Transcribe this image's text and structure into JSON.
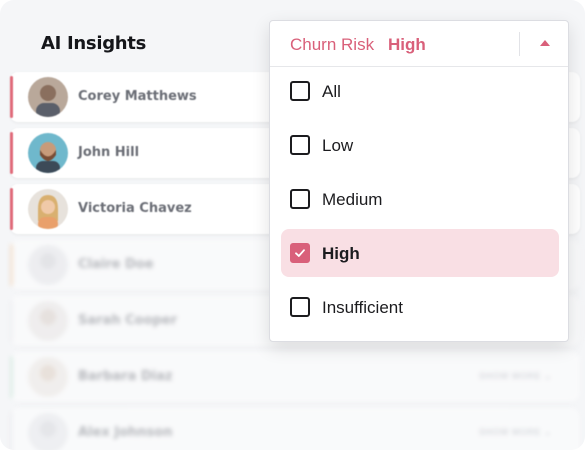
{
  "header": {
    "title": "AI Insights"
  },
  "filter": {
    "label": "Churn Risk",
    "value": "High",
    "accent_color": "#d9607a",
    "options": [
      {
        "label": "All",
        "checked": false
      },
      {
        "label": "Low",
        "checked": false
      },
      {
        "label": "Medium",
        "checked": false
      },
      {
        "label": "High",
        "checked": true
      },
      {
        "label": "Insufficient",
        "checked": false
      }
    ]
  },
  "contacts": [
    {
      "name": "Corey Matthews",
      "accent": "#e06b7a",
      "show_more": ""
    },
    {
      "name": "John Hill",
      "accent": "#e06b7a",
      "show_more": ""
    },
    {
      "name": "Victoria Chavez",
      "accent": "#e06b7a",
      "show_more": ""
    },
    {
      "name": "Claire Doe",
      "accent": "#f3c8a0",
      "show_more": ""
    },
    {
      "name": "Sarah Cooper",
      "accent": "#e8e8ec",
      "show_more": ""
    },
    {
      "name": "Barbara Diaz",
      "accent": "#bfe3d0",
      "show_more": "SHOW MORE ⌄"
    },
    {
      "name": "Alex Johnson",
      "accent": "#e8e8ec",
      "show_more": "SHOW MORE ⌄"
    }
  ]
}
